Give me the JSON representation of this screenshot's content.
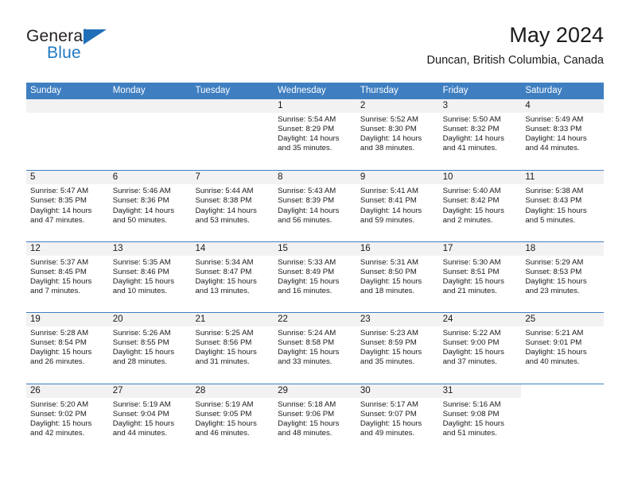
{
  "brand": {
    "line1": "General",
    "line2": "Blue",
    "logo_icon": "blue-triangle-logo"
  },
  "header": {
    "title": "May 2024",
    "subtitle": "Duncan, British Columbia, Canada"
  },
  "colors": {
    "header_blue": "#3f7fc1",
    "daynum_band": "#f2f2f2",
    "brand_blue": "#2079c4",
    "text": "#1a1a1a"
  },
  "calendar": {
    "weekdays": [
      "Sunday",
      "Monday",
      "Tuesday",
      "Wednesday",
      "Thursday",
      "Friday",
      "Saturday"
    ],
    "weeks": [
      [
        {
          "day": "",
          "empty": true
        },
        {
          "day": "",
          "empty": true
        },
        {
          "day": "",
          "empty": true
        },
        {
          "day": "1",
          "sunrise": "Sunrise: 5:54 AM",
          "sunset": "Sunset: 8:29 PM",
          "daylight_1": "Daylight: 14 hours",
          "daylight_2": "and 35 minutes."
        },
        {
          "day": "2",
          "sunrise": "Sunrise: 5:52 AM",
          "sunset": "Sunset: 8:30 PM",
          "daylight_1": "Daylight: 14 hours",
          "daylight_2": "and 38 minutes."
        },
        {
          "day": "3",
          "sunrise": "Sunrise: 5:50 AM",
          "sunset": "Sunset: 8:32 PM",
          "daylight_1": "Daylight: 14 hours",
          "daylight_2": "and 41 minutes."
        },
        {
          "day": "4",
          "sunrise": "Sunrise: 5:49 AM",
          "sunset": "Sunset: 8:33 PM",
          "daylight_1": "Daylight: 14 hours",
          "daylight_2": "and 44 minutes."
        }
      ],
      [
        {
          "day": "5",
          "sunrise": "Sunrise: 5:47 AM",
          "sunset": "Sunset: 8:35 PM",
          "daylight_1": "Daylight: 14 hours",
          "daylight_2": "and 47 minutes."
        },
        {
          "day": "6",
          "sunrise": "Sunrise: 5:46 AM",
          "sunset": "Sunset: 8:36 PM",
          "daylight_1": "Daylight: 14 hours",
          "daylight_2": "and 50 minutes."
        },
        {
          "day": "7",
          "sunrise": "Sunrise: 5:44 AM",
          "sunset": "Sunset: 8:38 PM",
          "daylight_1": "Daylight: 14 hours",
          "daylight_2": "and 53 minutes."
        },
        {
          "day": "8",
          "sunrise": "Sunrise: 5:43 AM",
          "sunset": "Sunset: 8:39 PM",
          "daylight_1": "Daylight: 14 hours",
          "daylight_2": "and 56 minutes."
        },
        {
          "day": "9",
          "sunrise": "Sunrise: 5:41 AM",
          "sunset": "Sunset: 8:41 PM",
          "daylight_1": "Daylight: 14 hours",
          "daylight_2": "and 59 minutes."
        },
        {
          "day": "10",
          "sunrise": "Sunrise: 5:40 AM",
          "sunset": "Sunset: 8:42 PM",
          "daylight_1": "Daylight: 15 hours",
          "daylight_2": "and 2 minutes."
        },
        {
          "day": "11",
          "sunrise": "Sunrise: 5:38 AM",
          "sunset": "Sunset: 8:43 PM",
          "daylight_1": "Daylight: 15 hours",
          "daylight_2": "and 5 minutes."
        }
      ],
      [
        {
          "day": "12",
          "sunrise": "Sunrise: 5:37 AM",
          "sunset": "Sunset: 8:45 PM",
          "daylight_1": "Daylight: 15 hours",
          "daylight_2": "and 7 minutes."
        },
        {
          "day": "13",
          "sunrise": "Sunrise: 5:35 AM",
          "sunset": "Sunset: 8:46 PM",
          "daylight_1": "Daylight: 15 hours",
          "daylight_2": "and 10 minutes."
        },
        {
          "day": "14",
          "sunrise": "Sunrise: 5:34 AM",
          "sunset": "Sunset: 8:47 PM",
          "daylight_1": "Daylight: 15 hours",
          "daylight_2": "and 13 minutes."
        },
        {
          "day": "15",
          "sunrise": "Sunrise: 5:33 AM",
          "sunset": "Sunset: 8:49 PM",
          "daylight_1": "Daylight: 15 hours",
          "daylight_2": "and 16 minutes."
        },
        {
          "day": "16",
          "sunrise": "Sunrise: 5:31 AM",
          "sunset": "Sunset: 8:50 PM",
          "daylight_1": "Daylight: 15 hours",
          "daylight_2": "and 18 minutes."
        },
        {
          "day": "17",
          "sunrise": "Sunrise: 5:30 AM",
          "sunset": "Sunset: 8:51 PM",
          "daylight_1": "Daylight: 15 hours",
          "daylight_2": "and 21 minutes."
        },
        {
          "day": "18",
          "sunrise": "Sunrise: 5:29 AM",
          "sunset": "Sunset: 8:53 PM",
          "daylight_1": "Daylight: 15 hours",
          "daylight_2": "and 23 minutes."
        }
      ],
      [
        {
          "day": "19",
          "sunrise": "Sunrise: 5:28 AM",
          "sunset": "Sunset: 8:54 PM",
          "daylight_1": "Daylight: 15 hours",
          "daylight_2": "and 26 minutes."
        },
        {
          "day": "20",
          "sunrise": "Sunrise: 5:26 AM",
          "sunset": "Sunset: 8:55 PM",
          "daylight_1": "Daylight: 15 hours",
          "daylight_2": "and 28 minutes."
        },
        {
          "day": "21",
          "sunrise": "Sunrise: 5:25 AM",
          "sunset": "Sunset: 8:56 PM",
          "daylight_1": "Daylight: 15 hours",
          "daylight_2": "and 31 minutes."
        },
        {
          "day": "22",
          "sunrise": "Sunrise: 5:24 AM",
          "sunset": "Sunset: 8:58 PM",
          "daylight_1": "Daylight: 15 hours",
          "daylight_2": "and 33 minutes."
        },
        {
          "day": "23",
          "sunrise": "Sunrise: 5:23 AM",
          "sunset": "Sunset: 8:59 PM",
          "daylight_1": "Daylight: 15 hours",
          "daylight_2": "and 35 minutes."
        },
        {
          "day": "24",
          "sunrise": "Sunrise: 5:22 AM",
          "sunset": "Sunset: 9:00 PM",
          "daylight_1": "Daylight: 15 hours",
          "daylight_2": "and 37 minutes."
        },
        {
          "day": "25",
          "sunrise": "Sunrise: 5:21 AM",
          "sunset": "Sunset: 9:01 PM",
          "daylight_1": "Daylight: 15 hours",
          "daylight_2": "and 40 minutes."
        }
      ],
      [
        {
          "day": "26",
          "sunrise": "Sunrise: 5:20 AM",
          "sunset": "Sunset: 9:02 PM",
          "daylight_1": "Daylight: 15 hours",
          "daylight_2": "and 42 minutes."
        },
        {
          "day": "27",
          "sunrise": "Sunrise: 5:19 AM",
          "sunset": "Sunset: 9:04 PM",
          "daylight_1": "Daylight: 15 hours",
          "daylight_2": "and 44 minutes."
        },
        {
          "day": "28",
          "sunrise": "Sunrise: 5:19 AM",
          "sunset": "Sunset: 9:05 PM",
          "daylight_1": "Daylight: 15 hours",
          "daylight_2": "and 46 minutes."
        },
        {
          "day": "29",
          "sunrise": "Sunrise: 5:18 AM",
          "sunset": "Sunset: 9:06 PM",
          "daylight_1": "Daylight: 15 hours",
          "daylight_2": "and 48 minutes."
        },
        {
          "day": "30",
          "sunrise": "Sunrise: 5:17 AM",
          "sunset": "Sunset: 9:07 PM",
          "daylight_1": "Daylight: 15 hours",
          "daylight_2": "and 49 minutes."
        },
        {
          "day": "31",
          "sunrise": "Sunrise: 5:16 AM",
          "sunset": "Sunset: 9:08 PM",
          "daylight_1": "Daylight: 15 hours",
          "daylight_2": "and 51 minutes."
        },
        {
          "day": "",
          "blank": true
        }
      ]
    ]
  }
}
